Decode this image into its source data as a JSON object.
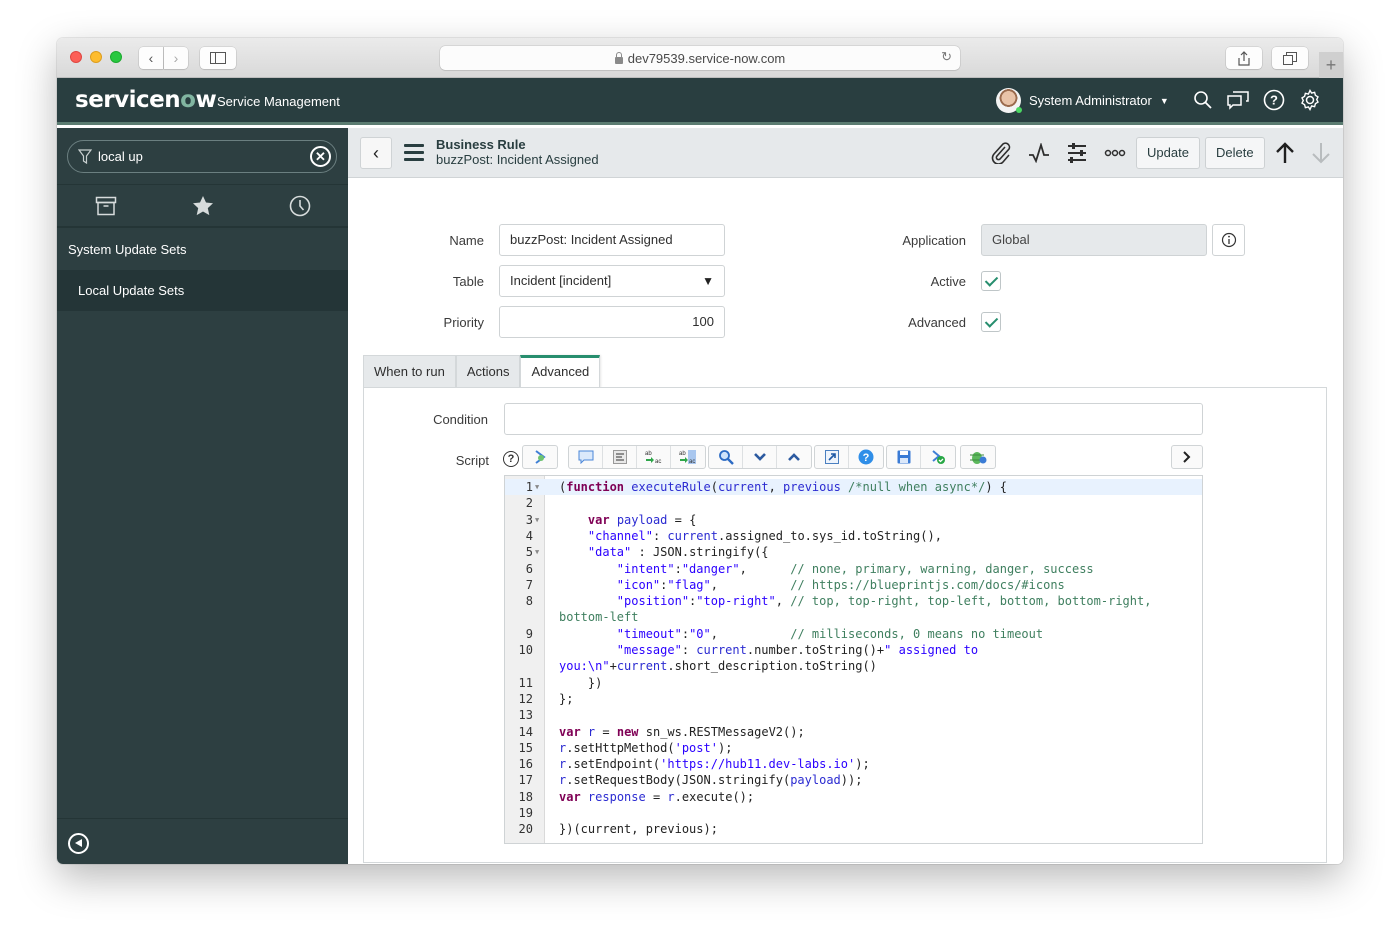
{
  "browser": {
    "url": "dev79539.service-now.com"
  },
  "header": {
    "logo_prefix": "servicen",
    "logo_o": "o",
    "logo_suffix": "w",
    "product": "Service Management",
    "user_name": "System Administrator"
  },
  "sidebar": {
    "filter_value": "local up",
    "items": [
      {
        "label": "System Update Sets"
      },
      {
        "label": "Local Update Sets"
      }
    ]
  },
  "form": {
    "record_type": "Business Rule",
    "record_name": "buzzPost: Incident Assigned",
    "buttons": {
      "update": "Update",
      "delete": "Delete"
    },
    "fields": {
      "name": {
        "label": "Name",
        "value": "buzzPost: Incident Assigned"
      },
      "table": {
        "label": "Table",
        "value": "Incident [incident]"
      },
      "priority": {
        "label": "Priority",
        "value": "100"
      },
      "application": {
        "label": "Application",
        "value": "Global"
      },
      "active": {
        "label": "Active",
        "checked": true
      },
      "advanced": {
        "label": "Advanced",
        "checked": true
      }
    },
    "tabs": [
      {
        "label": "When to run"
      },
      {
        "label": "Actions"
      },
      {
        "label": "Advanced",
        "active": true
      }
    ],
    "condition_label": "Condition",
    "condition_value": "",
    "script_label": "Script"
  },
  "script": {
    "lines": [
      {
        "n": "1",
        "fold": true,
        "html": "(<span class='kw'>function</span> <span class='fn'>executeRule</span>(<span class='var'>current</span>, <span class='var'>previous</span> <span class='cm'>/*null when async*/</span>) {"
      },
      {
        "n": "2",
        "html": ""
      },
      {
        "n": "3",
        "fold": true,
        "html": "    <span class='kw'>var</span> <span class='var'>payload</span> = {"
      },
      {
        "n": "4",
        "html": "    <span class='str'>\"channel\"</span>: <span class='var'>current</span>.assigned_to.sys_id.toString(),"
      },
      {
        "n": "5",
        "fold": true,
        "html": "    <span class='str'>\"data\"</span> : JSON.stringify({"
      },
      {
        "n": "6",
        "html": "        <span class='str'>\"intent\"</span>:<span class='str'>\"danger\"</span>,      <span class='cm'>// none, primary, warning, danger, success</span>"
      },
      {
        "n": "7",
        "html": "        <span class='str'>\"icon\"</span>:<span class='str'>\"flag\"</span>,          <span class='cm'>// https://blueprintjs.com/docs/#icons</span>"
      },
      {
        "n": "8",
        "html": "        <span class='str'>\"position\"</span>:<span class='str'>\"top-right\"</span>, <span class='cm'>// top, top-right, top-left, bottom, bottom-right,</span>"
      },
      {
        "n": "",
        "html": "<span class='cm'>bottom-left</span>"
      },
      {
        "n": "9",
        "html": "        <span class='str'>\"timeout\"</span>:<span class='str'>\"0\"</span>,          <span class='cm'>// milliseconds, 0 means no timeout</span>"
      },
      {
        "n": "10",
        "html": "        <span class='str'>\"message\"</span>: <span class='var'>current</span>.number.toString()+<span class='str'>\" assigned to</span>"
      },
      {
        "n": "",
        "html": "<span class='str'>you:\\n\"</span>+<span class='var'>current</span>.short_description.toString()"
      },
      {
        "n": "11",
        "html": "    })"
      },
      {
        "n": "12",
        "html": "};"
      },
      {
        "n": "13",
        "html": ""
      },
      {
        "n": "14",
        "html": "<span class='kw'>var</span> <span class='var'>r</span> = <span class='kw'>new</span> sn_ws.RESTMessageV2();"
      },
      {
        "n": "15",
        "html": "<span class='var'>r</span>.setHttpMethod(<span class='str'>'post'</span>);"
      },
      {
        "n": "16",
        "html": "<span class='var'>r</span>.setEndpoint(<span class='str'>'https://hub11.dev-labs.io'</span>);"
      },
      {
        "n": "17",
        "html": "<span class='var'>r</span>.setRequestBody(JSON.stringify(<span class='var'>payload</span>));"
      },
      {
        "n": "18",
        "html": "<span class='kw'>var</span> <span class='var'>response</span> = <span class='var'>r</span>.execute();"
      },
      {
        "n": "19",
        "html": ""
      },
      {
        "n": "20",
        "html": "})(current, previous);"
      }
    ]
  },
  "colors": {
    "header_bg": "#293e40",
    "sidebar_bg": "#2d3f41",
    "accent": "#278e6e",
    "logo_accent": "#81b5a1"
  }
}
